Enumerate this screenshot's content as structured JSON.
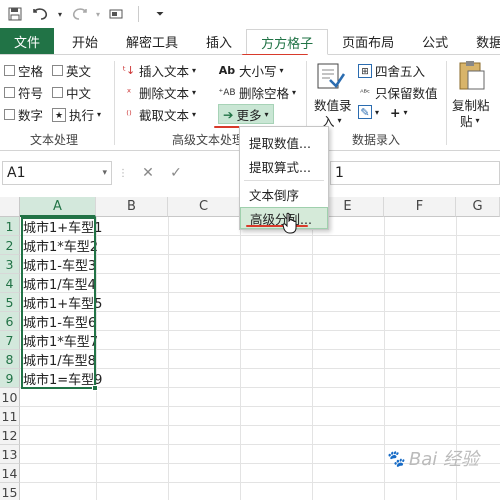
{
  "qat": {
    "save_icon": "save-icon",
    "undo_icon": "undo-icon",
    "redo_icon": "redo-icon",
    "customize_icon": "customize-icon"
  },
  "tabs": [
    {
      "label": "文件"
    },
    {
      "label": "开始"
    },
    {
      "label": "解密工具"
    },
    {
      "label": "插入"
    },
    {
      "label": "方方格子"
    },
    {
      "label": "页面布局"
    },
    {
      "label": "公式"
    },
    {
      "label": "数据"
    }
  ],
  "ribbon": {
    "text_group": {
      "label": "文本处理",
      "items": [
        "空格",
        "英文",
        "符号",
        "中文",
        "数字",
        "执行"
      ]
    },
    "advanced_group": {
      "label": "高级文本处理",
      "insert_text": "插入文本",
      "delete_text": "删除文本",
      "extract_text": "截取文本",
      "case": "大小写",
      "delete_space": "删除空格",
      "more": "更多"
    },
    "data_group": {
      "label": "数据录入",
      "entry_top": "数值录",
      "entry_bottom": "入",
      "round": "四舍五入",
      "keep_value": "只保留数值",
      "plus": "+"
    },
    "copy_group": {
      "top": "复制粘",
      "bottom": "贴"
    }
  },
  "formula_bar": {
    "name_box": "A1",
    "formula_value": "1"
  },
  "dropdown": {
    "items": [
      "提取数值...",
      "提取算式...",
      "文本倒序",
      "高级分列..."
    ]
  },
  "grid": {
    "columns": [
      "A",
      "B",
      "C",
      "D",
      "E",
      "F",
      "G"
    ],
    "rows": [
      "1",
      "2",
      "3",
      "4",
      "5",
      "6",
      "7",
      "8",
      "9",
      "10",
      "11",
      "12",
      "13",
      "14",
      "15"
    ],
    "cells_a": [
      "城市1+车型1",
      "城市1*车型2",
      "城市1-车型3",
      "城市1/车型4",
      "城市1+车型5",
      "城市1-车型6",
      "城市1*车型7",
      "城市1/车型8",
      "城市1=车型9"
    ]
  },
  "watermark": "Bai 经验"
}
